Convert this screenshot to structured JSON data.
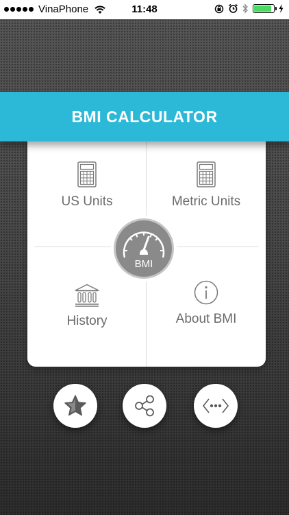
{
  "status_bar": {
    "carrier": "VinaPhone",
    "time": "11:48",
    "battery_level": 0.9
  },
  "header": {
    "title": "BMI CALCULATOR"
  },
  "menu": {
    "items": [
      {
        "label": "US Units",
        "icon": "calculator-icon"
      },
      {
        "label": "Metric Units",
        "icon": "calculator-icon"
      },
      {
        "label": "History",
        "icon": "building-icon"
      },
      {
        "label": "About BMI",
        "icon": "info-icon"
      }
    ],
    "center_badge": "BMI"
  },
  "actions": [
    {
      "icon": "star-icon"
    },
    {
      "icon": "share-icon"
    },
    {
      "icon": "more-apps-icon"
    }
  ],
  "colors": {
    "accent": "#2cb9d8",
    "card_text": "#6b6b6b",
    "badge": "#8a8a8a",
    "battery": "#4cd964"
  }
}
